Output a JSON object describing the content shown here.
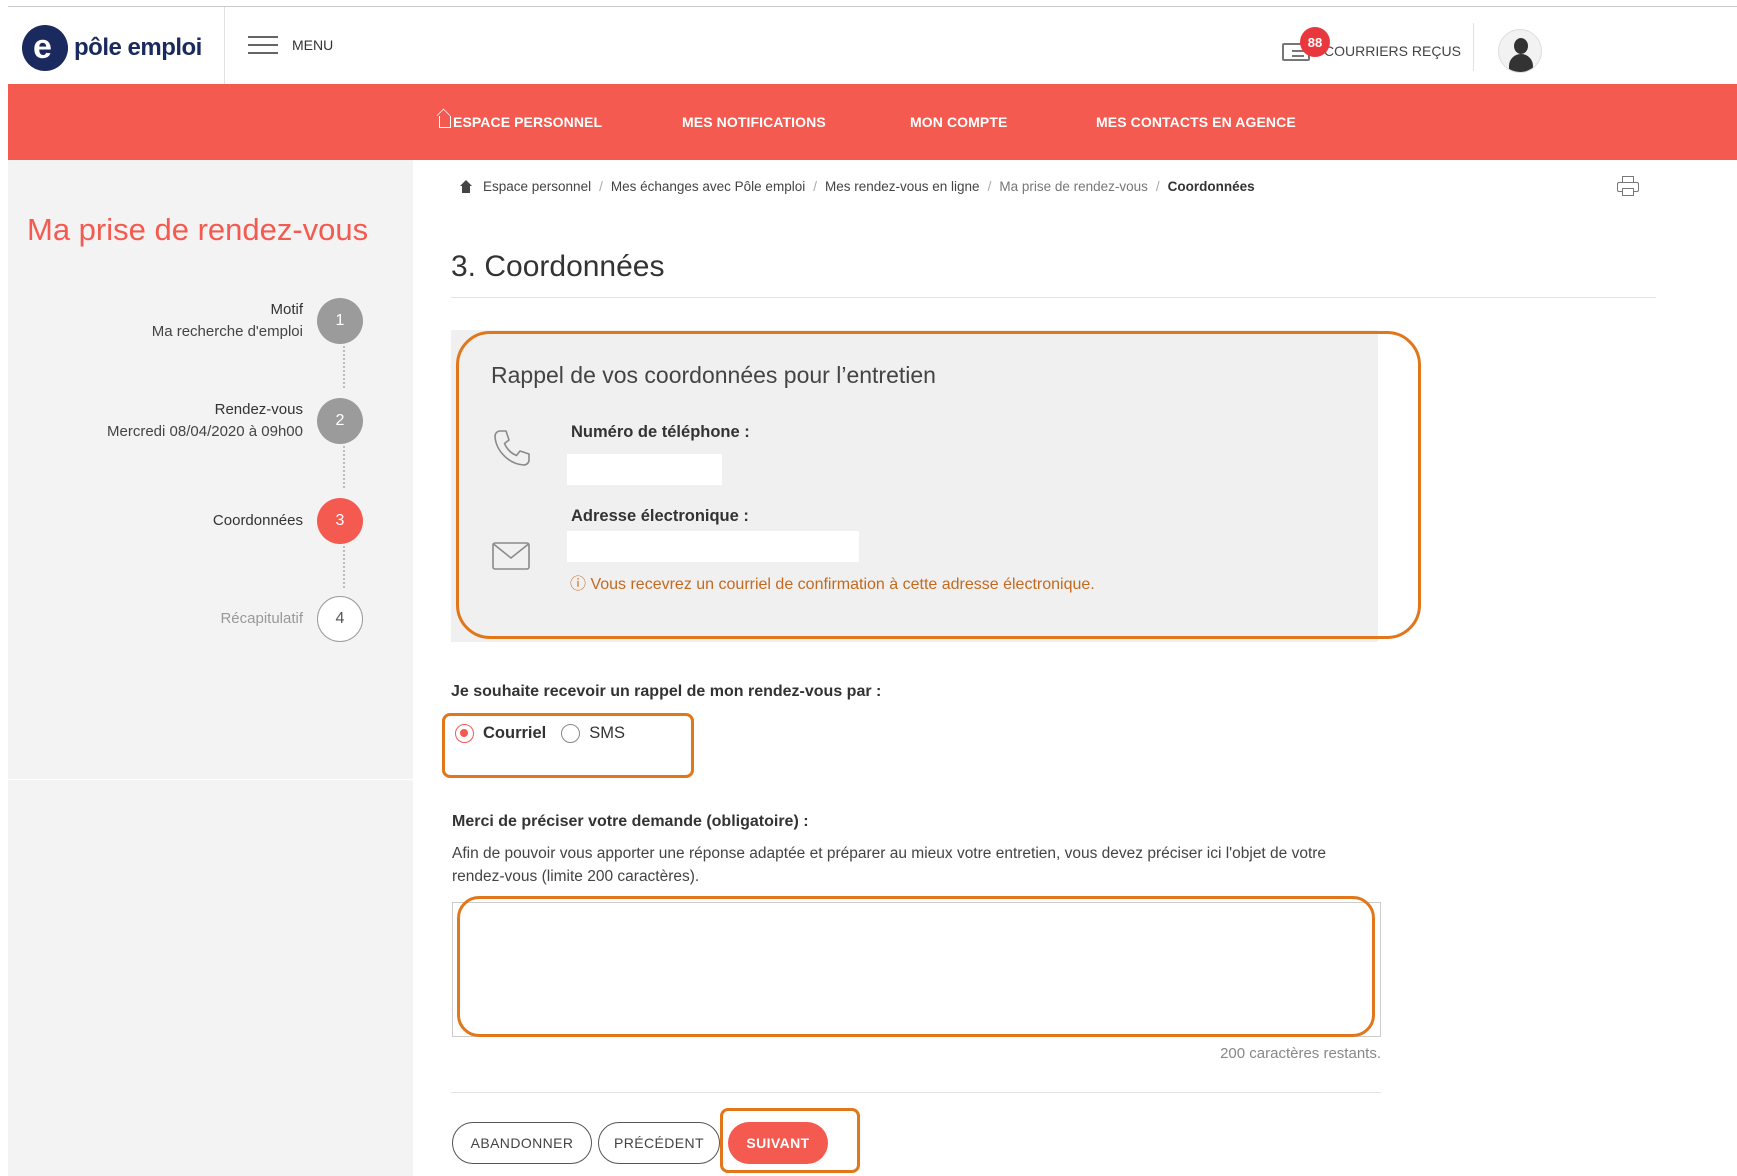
{
  "header": {
    "logo_text": "pôle emploi",
    "menu_label": "MENU",
    "mail_badge": "88",
    "mail_label": "COURRIERS REÇUS"
  },
  "nav": {
    "items": [
      {
        "label": "ESPACE PERSONNEL",
        "icon": "home-icon"
      },
      {
        "label": "MES NOTIFICATIONS"
      },
      {
        "label": "MON COMPTE"
      },
      {
        "label": "MES CONTACTS EN AGENCE"
      }
    ]
  },
  "sidebar": {
    "title": "Ma prise de rendez-vous",
    "steps": [
      {
        "number": "1",
        "title": "Motif",
        "subtitle": "Ma recherche d'emploi",
        "state": "done"
      },
      {
        "number": "2",
        "title": "Rendez-vous",
        "subtitle": "Mercredi 08/04/2020 à 09h00",
        "state": "done"
      },
      {
        "number": "3",
        "title": "Coordonnées",
        "subtitle": "",
        "state": "active"
      },
      {
        "number": "4",
        "title": "Récapitulatif",
        "subtitle": "",
        "state": "todo"
      }
    ]
  },
  "breadcrumb": {
    "items": [
      "Espace personnel",
      "Mes échanges avec Pôle emploi",
      "Mes rendez-vous en ligne",
      "Ma prise de rendez-vous",
      "Coordonnées"
    ],
    "separator": "/"
  },
  "main": {
    "title": "3. Coordonnées",
    "info_box": {
      "title": "Rappel de vos coordonnées pour l’entretien",
      "phone_label": "Numéro de téléphone :",
      "phone_value": "",
      "email_label": "Adresse électronique :",
      "email_value": "",
      "confirmation_note": "ⓘ Vous recevrez un courriel de confirmation à cette adresse électronique."
    },
    "reminder": {
      "label": "Je souhaite recevoir un rappel de mon rendez-vous par :",
      "options": [
        "Courriel",
        "SMS"
      ],
      "selected": "Courriel"
    },
    "request": {
      "label": "Merci de préciser votre demande (obligatoire) :",
      "help": "Afin de pouvoir vous apporter une réponse adaptée et préparer au mieux votre entretien, vous devez préciser ici l'objet de votre rendez-vous (limite 200 caractères).",
      "value": "",
      "remaining": "200 caractères restants."
    },
    "buttons": {
      "abandon": "ABANDONNER",
      "previous": "PRÉCÉDENT",
      "next": "SUIVANT"
    }
  },
  "colors": {
    "brand_red": "#f45a4f",
    "brand_navy": "#1a2a5e",
    "highlight_orange": "#e2761b",
    "note_orange": "#c46a1e"
  }
}
